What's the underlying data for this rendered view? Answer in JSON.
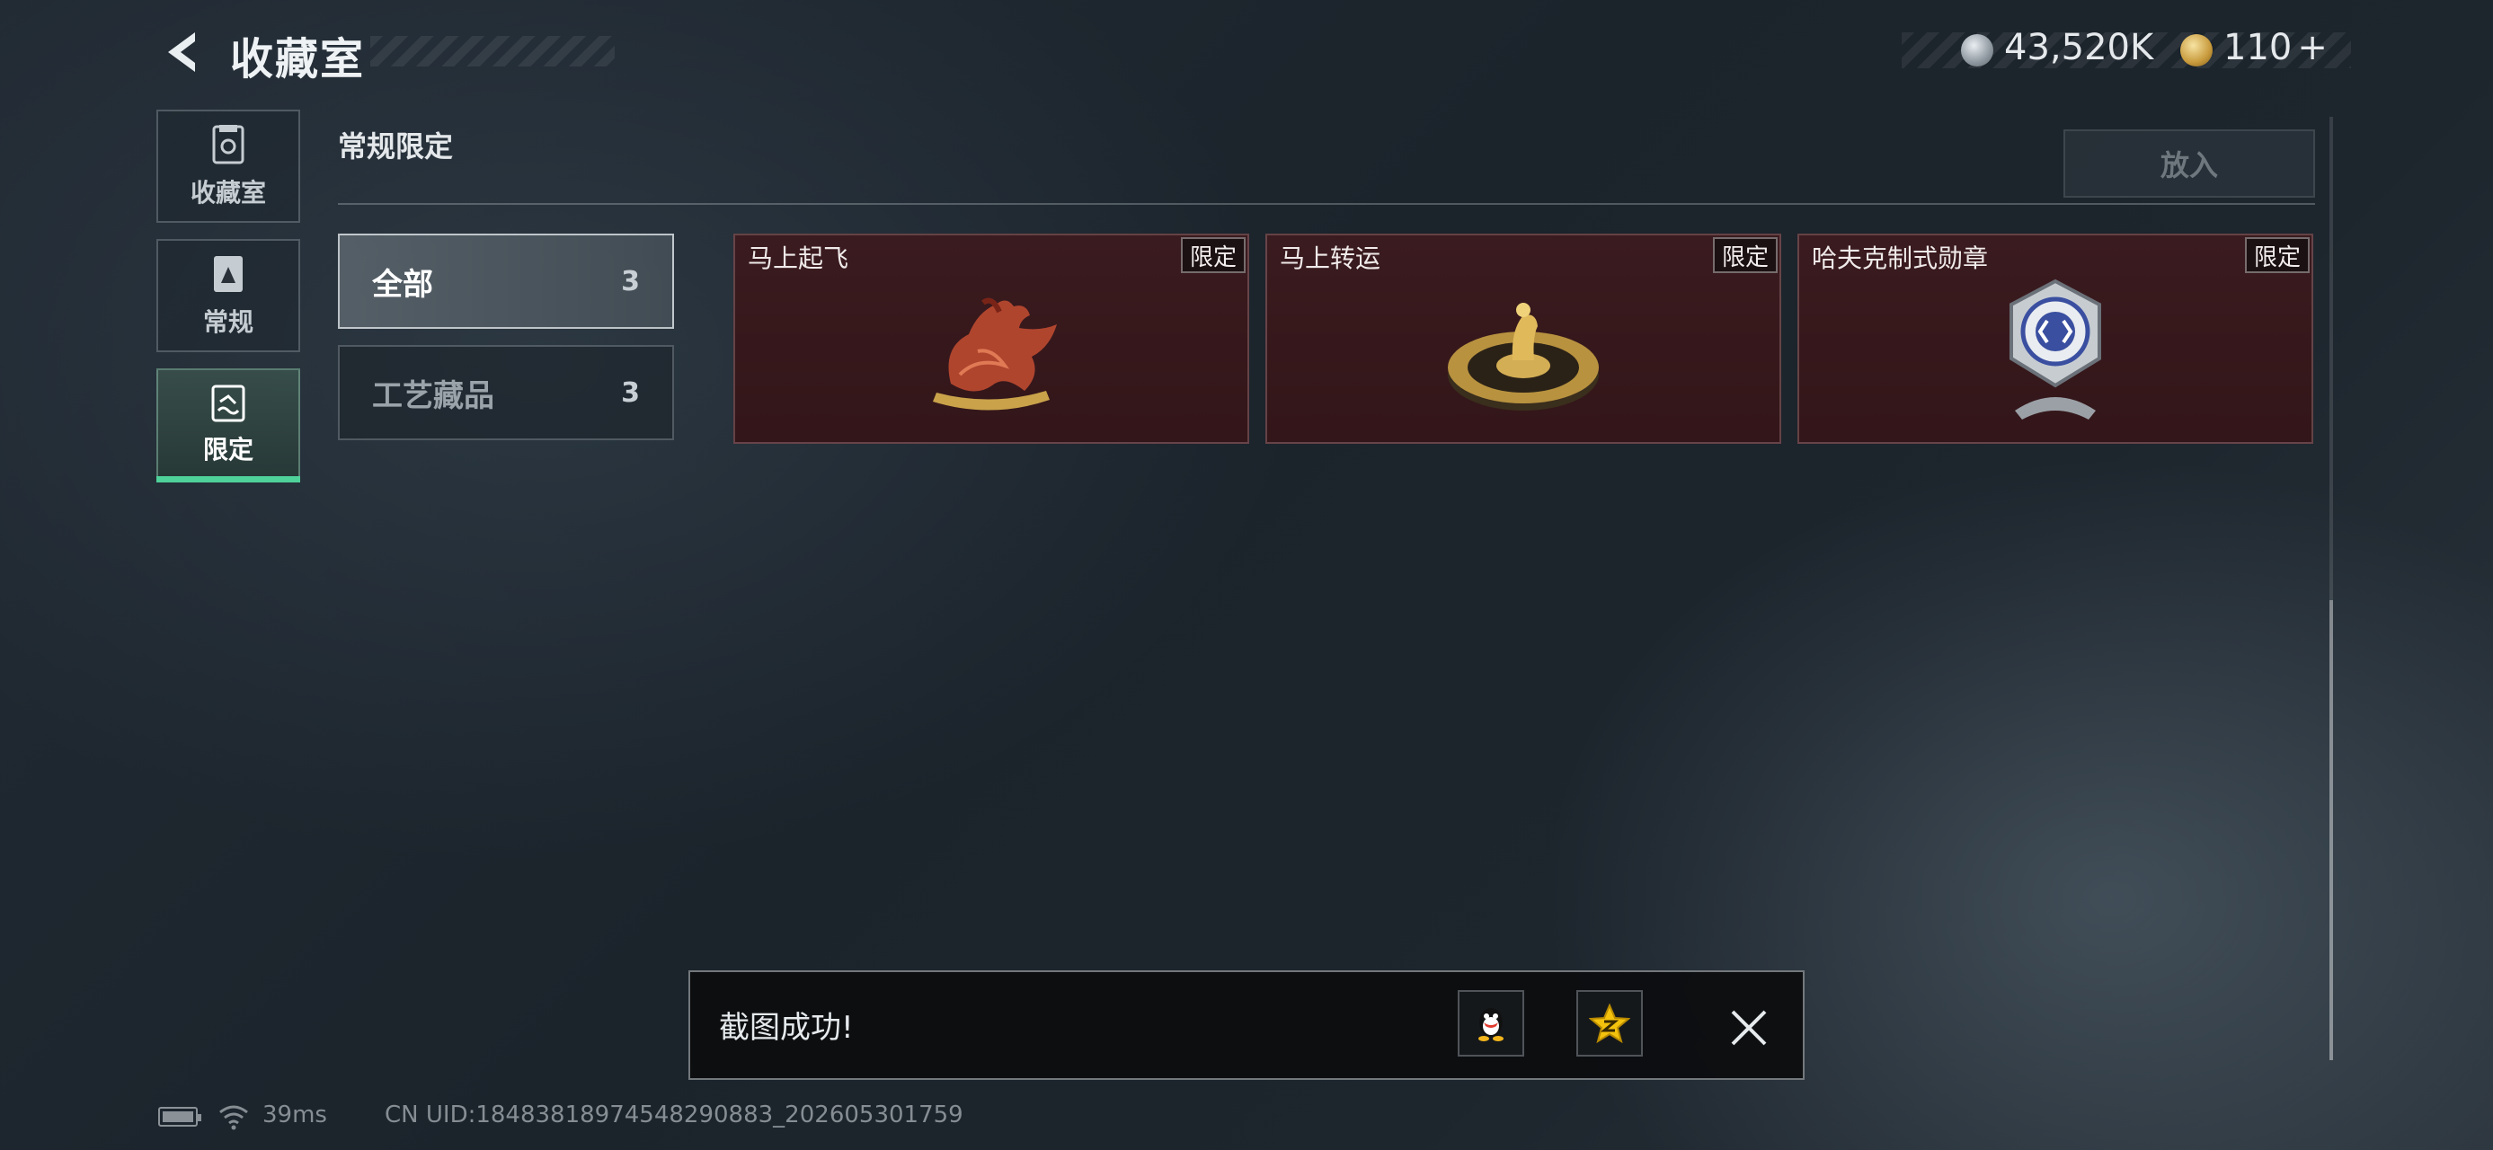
{
  "header": {
    "title": "收藏室",
    "currency": {
      "silver_amount": "43,520K",
      "gold_amount": "110",
      "add_label": "+"
    }
  },
  "nav": {
    "items": [
      {
        "label": "收藏室",
        "icon": "collection-room-icon",
        "active": false
      },
      {
        "label": "常规",
        "icon": "regular-card-icon",
        "active": false
      },
      {
        "label": "限定",
        "icon": "limited-swim-icon",
        "active": true
      }
    ]
  },
  "section": {
    "title": "常规限定",
    "place_button_label": "放入"
  },
  "filters": [
    {
      "label": "全部",
      "count": "3",
      "active": true
    },
    {
      "label": "工艺藏品",
      "count": "3",
      "active": false
    }
  ],
  "items": [
    {
      "name": "马上起飞",
      "tag": "限定",
      "icon": "flying-horse-icon"
    },
    {
      "name": "马上转运",
      "tag": "限定",
      "icon": "horse-fortune-wheel-icon"
    },
    {
      "name": "哈夫克制式勋章",
      "tag": "限定",
      "icon": "haavk-medal-icon"
    }
  ],
  "toast": {
    "message": "截图成功!",
    "share_targets": [
      "qq-penguin-icon",
      "qzone-star-icon"
    ],
    "close_icon": "close-icon"
  },
  "status": {
    "ping": "39ms",
    "uid": "CN UID:18483818974548290883_202605301759"
  },
  "colors": {
    "accent_green": "#4fd19a",
    "card_bg": "#3a1b1f"
  }
}
